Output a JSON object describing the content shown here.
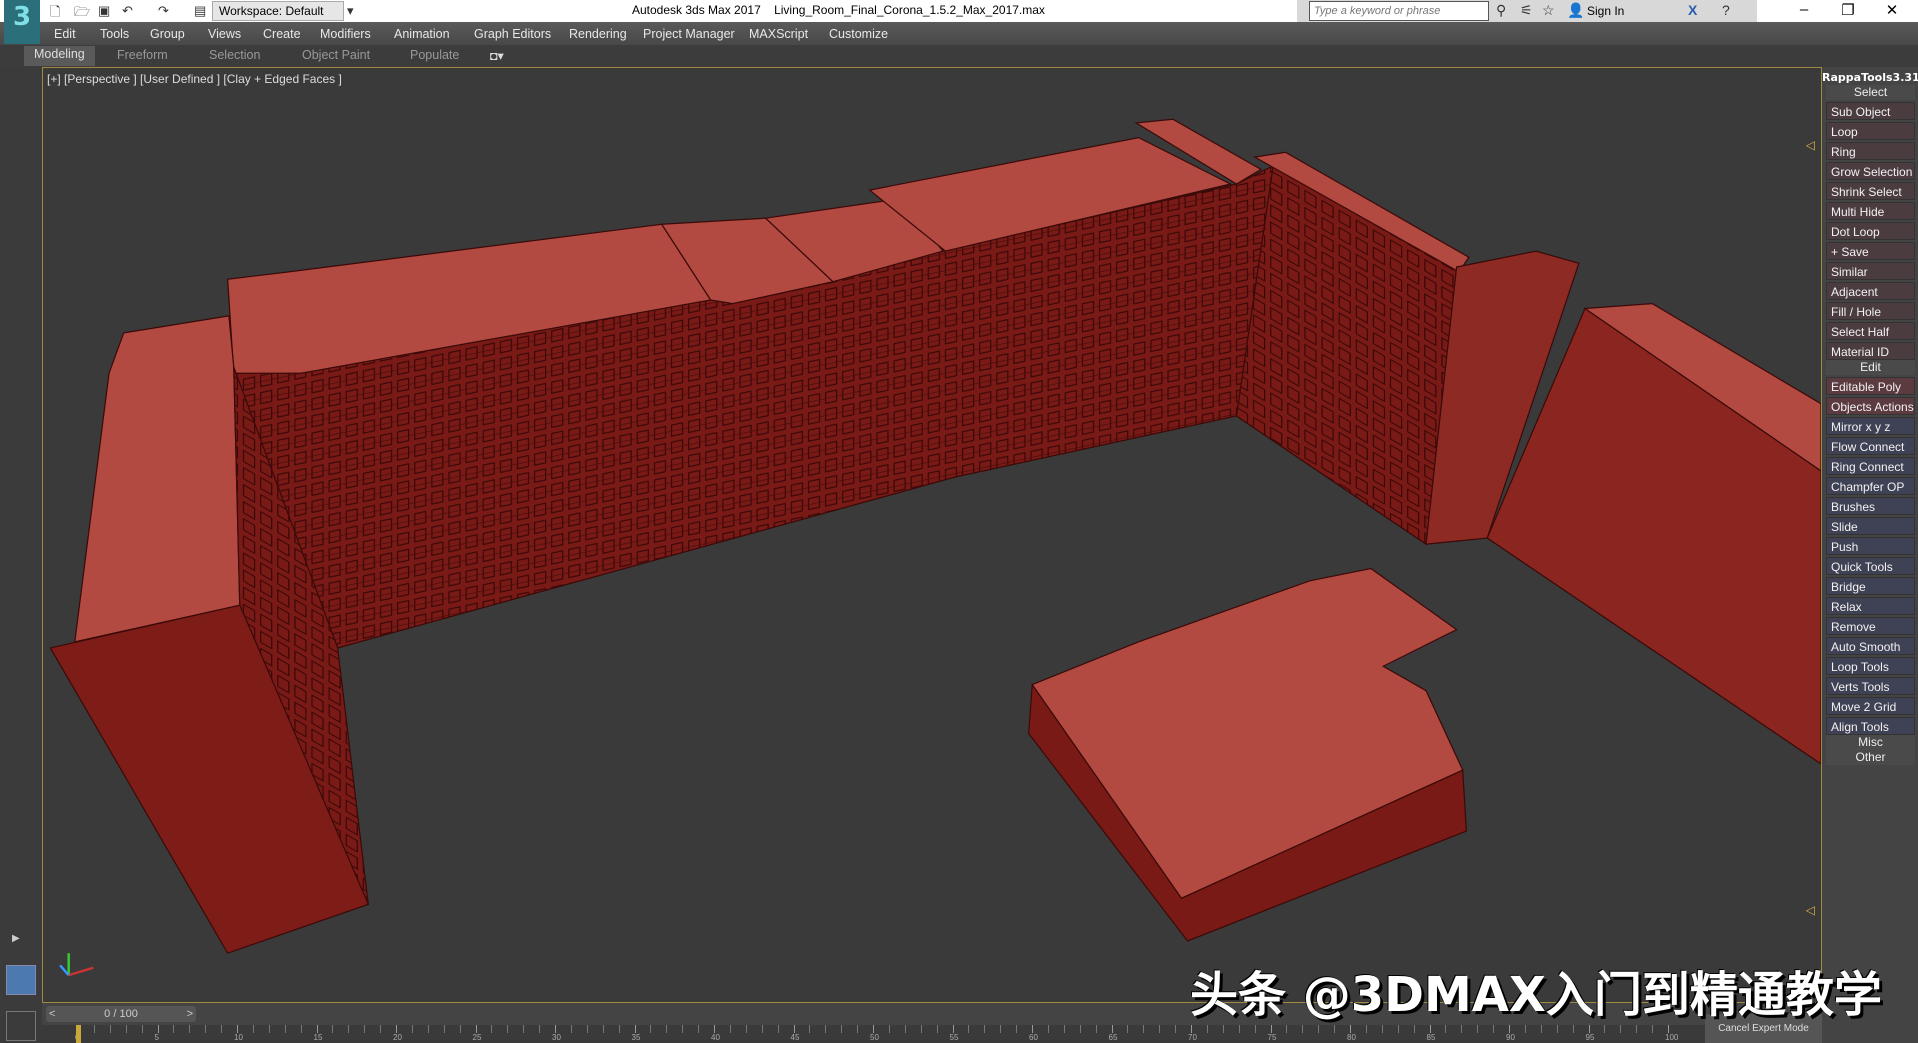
{
  "titlebar": {
    "workspace": "Workspace: Default",
    "app_title": "Autodesk 3ds Max 2017",
    "file_name": "Living_Room_Final_Corona_1.5.2_Max_2017.max",
    "search_placeholder": "Type a keyword or phrase",
    "sign_in": "Sign In",
    "logo": "3"
  },
  "menu": [
    "Edit",
    "Tools",
    "Group",
    "Views",
    "Create",
    "Modifiers",
    "Animation",
    "Graph Editors",
    "Rendering",
    "Project Manager",
    "MAXScript",
    "Customize"
  ],
  "ribbon": {
    "tabs": [
      "Modeling",
      "Freeform",
      "Selection",
      "Object Paint",
      "Populate"
    ],
    "active": "Modeling"
  },
  "viewport": {
    "label": "[+] [Perspective ] [User Defined ] [Clay + Edged Faces ]",
    "model_color": "#b34a42"
  },
  "watermark": "头条 @3DMAX入门到精通教学",
  "panel": {
    "title": "RappaTools3.31",
    "sections": [
      {
        "label": "Select",
        "items": [
          "Sub Object",
          "Loop",
          "Ring",
          "Grow Selection",
          "Shrink Select",
          "Multi Hide",
          "Dot Loop",
          "+ Save",
          "Similar",
          "Adjacent",
          "Fill / Hole",
          "Select Half",
          "Material ID"
        ]
      },
      {
        "label": "Edit",
        "items": [
          "Editable Poly",
          "Objects Actions",
          "Mirror   x  y  z",
          "Flow Connect",
          "Ring Connect",
          "Champfer OP",
          "Brushes",
          "Slide",
          "Push",
          "Quick Tools",
          "Bridge",
          "Relax",
          "Remove",
          "Auto Smooth",
          "Loop Tools",
          "Verts Tools",
          "Move 2 Grid",
          "Align Tools"
        ]
      },
      {
        "label": "Misc",
        "items": []
      },
      {
        "label": "Other",
        "items": []
      }
    ]
  },
  "timeline": {
    "frame": "0 / 100",
    "current": 0,
    "end": 100,
    "ticks": [
      "0",
      "5",
      "10",
      "15",
      "20",
      "25",
      "30",
      "35",
      "40",
      "45",
      "50",
      "55",
      "60",
      "65",
      "70",
      "75",
      "80",
      "85",
      "90",
      "95",
      "100"
    ]
  },
  "cancel_expert": "Cancel Expert Mode"
}
